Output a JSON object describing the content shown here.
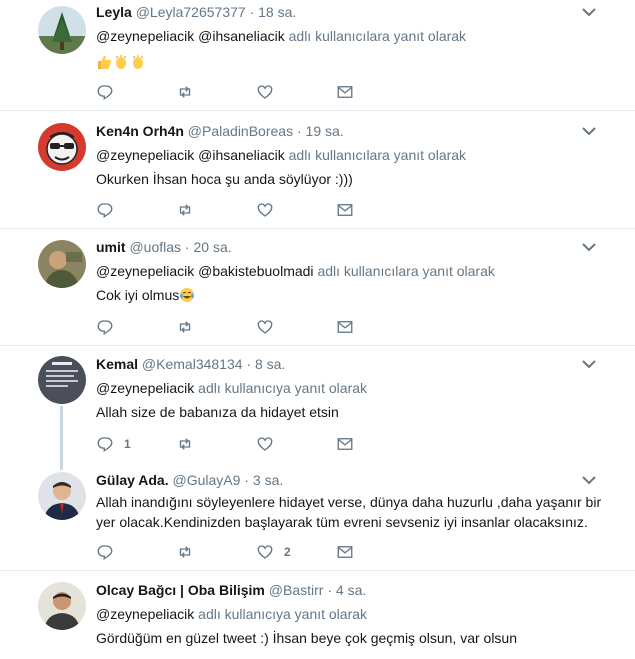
{
  "tweets": [
    {
      "name": "Leyla",
      "handle": "@Leyla72657377",
      "time": "18 sa.",
      "reply_prefix": "",
      "reply_mentions": "@zeynepeliacik @ihsaneliacik",
      "reply_suffix": "adlı kullanıcılara yanıt olarak",
      "text": "",
      "emojis": [
        "thumbs-up",
        "clapping-hands",
        "clapping-hands"
      ],
      "reply_count": "",
      "retweet_count": "",
      "like_count": ""
    },
    {
      "name": "Ken4n Orh4n",
      "handle": "@PaladinBoreas",
      "time": "19 sa.",
      "reply_mentions": "@zeynepeliacik @ihsaneliacik",
      "reply_suffix": "adlı kullanıcılara yanıt olarak",
      "text": "Okurken İhsan hoca şu anda söylüyor :)))",
      "reply_count": "",
      "retweet_count": "",
      "like_count": ""
    },
    {
      "name": "umit",
      "handle": "@uoflas",
      "time": "20 sa.",
      "reply_mentions": "@zeynepeliacik @bakistebuolmadi",
      "reply_suffix": "adlı kullanıcılara yanıt olarak",
      "text": "Cok iyi olmus",
      "emojis": [
        "tears-of-joy"
      ],
      "reply_count": "",
      "retweet_count": "",
      "like_count": ""
    },
    {
      "name": "Kemal",
      "handle": "@Kemal348134",
      "time": "8 sa.",
      "reply_mentions": "@zeynepeliacik",
      "reply_suffix": "adlı kullanıcıya yanıt olarak",
      "text": "Allah size de babanıza da hidayet etsin",
      "reply_count": "1",
      "retweet_count": "",
      "like_count": ""
    },
    {
      "name": "Gülay Ada.",
      "handle": "@GulayA9",
      "time": "3 sa.",
      "text": "Allah inandığını söyleyenlere hidayet verse, dünya daha huzurlu ,daha yaşanır bir yer olacak.Kendinizden başlayarak tüm evreni sevseniz iyi insanlar olacaksınız.",
      "reply_count": "",
      "retweet_count": "",
      "like_count": "2"
    },
    {
      "name": "Olcay Bağcı | Oba Bilişim",
      "handle": "@Bastirr",
      "time": "4 sa.",
      "reply_mentions": "@zeynepeliacik",
      "reply_suffix": "adlı kullanıcıya yanıt olarak",
      "text": "Gördüğüm en güzel tweet :) İhsan beye çok geçmiş olsun, var olsun"
    }
  ],
  "separator": " · ",
  "colors": {
    "secondary": "#657786",
    "primary": "#14171a",
    "divider": "#e6ecf0",
    "thread": "#ccd6dd"
  },
  "icons": {
    "reply": "reply-icon",
    "retweet": "retweet-icon",
    "like": "heart-icon",
    "dm": "envelope-icon",
    "menu": "chevron-down-icon"
  }
}
